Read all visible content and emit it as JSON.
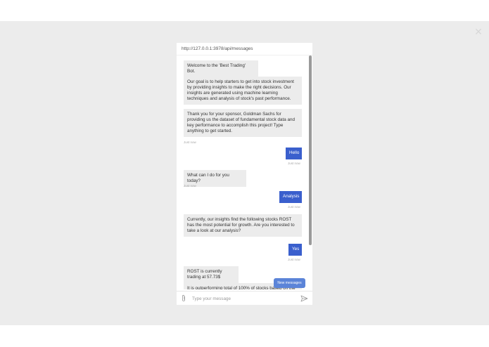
{
  "header": {
    "url": "http://127.0.0.1:3978/api/messages"
  },
  "overlay": {
    "close_icon": "close-icon"
  },
  "messages": [
    {
      "from": "bot",
      "text": "Welcome to the 'Best Trading' Bot."
    },
    {
      "from": "bot",
      "text": "Our goal is to help starters to get into stock investment by providing insights to make the right decisions. Our insights are generated using machine learning techniques and analysis of stock's past performance."
    },
    {
      "from": "bot",
      "text": "Thank you for your sponsor, Goldman Sachs for providing us the dataset of fundamental stock data and key performance to accomplish this project! Type anything to get started.",
      "time": "Just now"
    },
    {
      "from": "user",
      "text": "Hello",
      "time": "Just now"
    },
    {
      "from": "bot",
      "text": "What can I do for you today?",
      "time": "Just now"
    },
    {
      "from": "user",
      "text": "Analysis",
      "time": "Just now"
    },
    {
      "from": "bot",
      "text": "Currently, our insights find the following stocks ROST has the most potential for growth. Are you interested to take a look at our analysis?"
    },
    {
      "from": "user",
      "text": "Yes",
      "time": "Just now"
    },
    {
      "from": "bot",
      "text": "ROST is currently trading at 57.73$"
    },
    {
      "from": "bot",
      "text": "It is outperforming total of 100% of stocks based on the"
    }
  ],
  "new_messages_button": "New messages",
  "composer": {
    "placeholder": "Type your message",
    "value": ""
  },
  "colors": {
    "user_bubble": "#3a5fcd",
    "bot_bubble": "#ececec",
    "overlay": "#ececec"
  }
}
